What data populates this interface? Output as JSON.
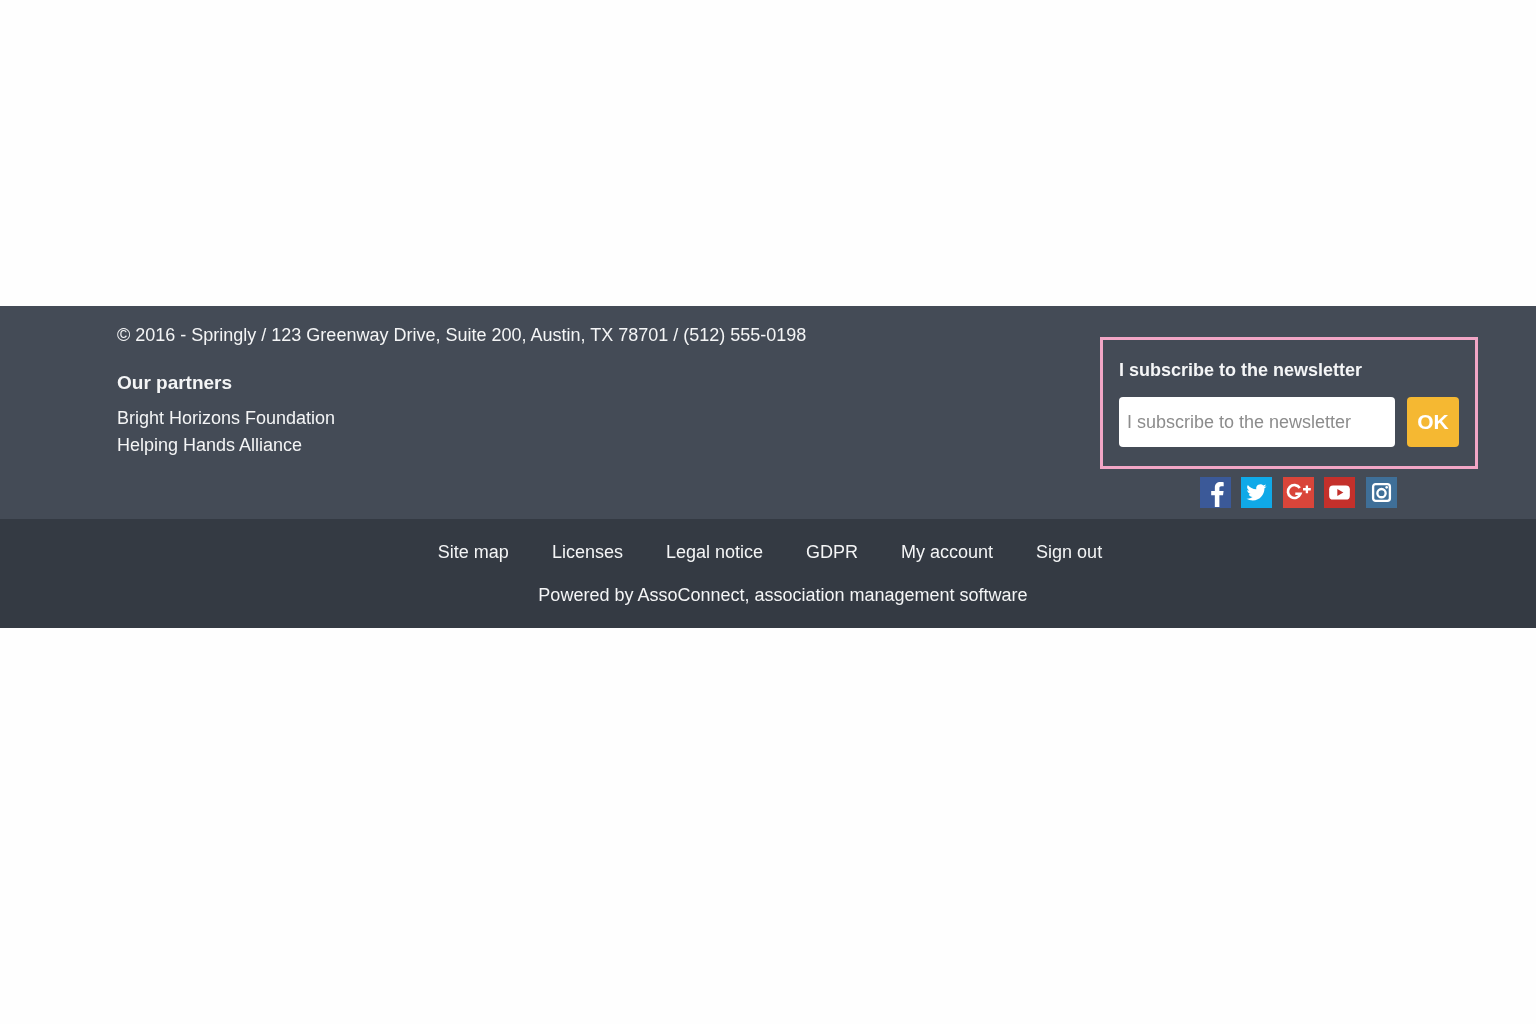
{
  "footer": {
    "address": "© 2016 - Springly / 123 Greenway Drive, Suite 200, Austin, TX 78701 / (512) 555-0198",
    "partners": {
      "title": "Our partners",
      "items": [
        "Bright Horizons Foundation",
        "Helping Hands Alliance"
      ]
    },
    "newsletter": {
      "highlighted": true,
      "title": "I subscribe to the newsletter",
      "placeholder": "I subscribe to the newsletter",
      "button": "OK"
    },
    "social": [
      {
        "kind": "facebook",
        "color": "#3b5998"
      },
      {
        "kind": "twitter",
        "color": "#10a9e8"
      },
      {
        "kind": "google-plus",
        "color": "#d9453a"
      },
      {
        "kind": "youtube",
        "color": "#c4302b"
      },
      {
        "kind": "instagram",
        "color": "#3f6f98"
      }
    ]
  },
  "bottom_bar": {
    "links": [
      "Site map",
      "Licenses",
      "Legal notice",
      "GDPR",
      "My account",
      "Sign out"
    ],
    "powered_by": "Powered by AssoConnect, association management software"
  }
}
